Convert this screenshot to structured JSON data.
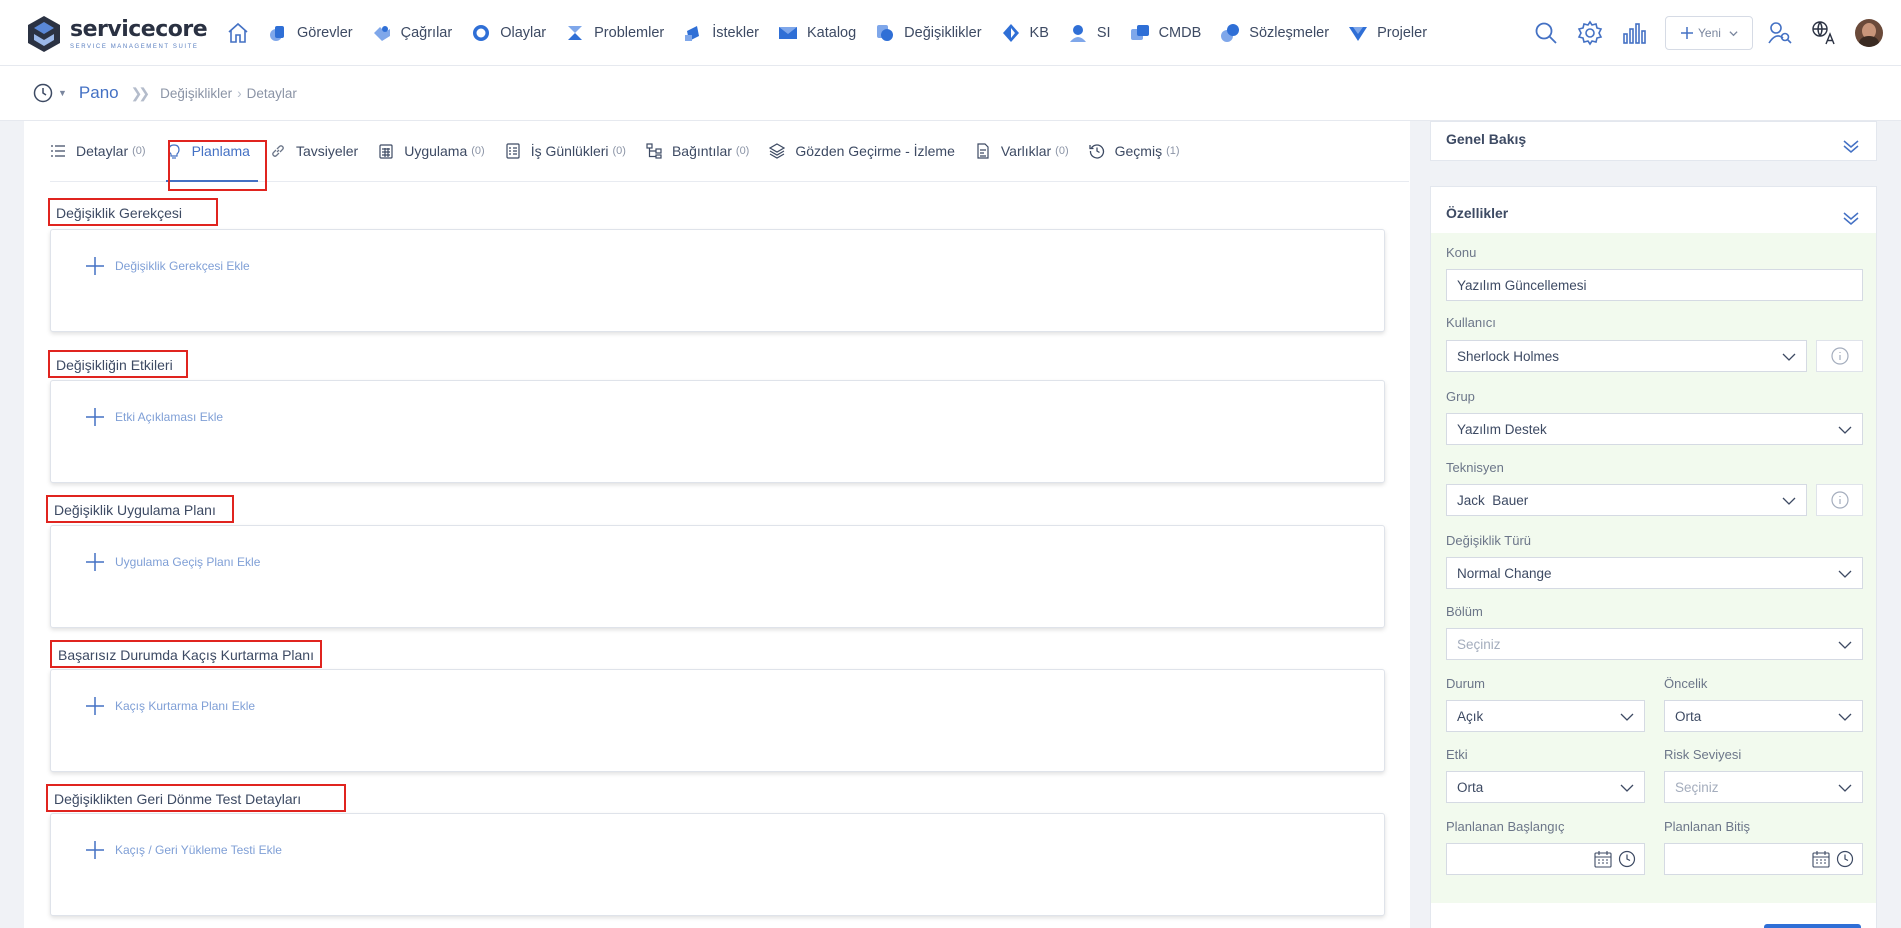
{
  "app": {
    "logo_title": "servicecore",
    "logo_subtitle": "SERVICE MANAGEMENT SUITE"
  },
  "colors": {
    "accent": "#4471c4",
    "highlight": "#e0241f",
    "panel_bg": "#f2faee"
  },
  "nav": {
    "items": [
      {
        "label": "Görevler",
        "icon": "tasks-icon"
      },
      {
        "label": "Çağrılar",
        "icon": "calls-icon"
      },
      {
        "label": "Olaylar",
        "icon": "incidents-icon"
      },
      {
        "label": "Problemler",
        "icon": "problems-icon"
      },
      {
        "label": "İstekler",
        "icon": "requests-icon"
      },
      {
        "label": "Katalog",
        "icon": "catalog-icon"
      },
      {
        "label": "Değişiklikler",
        "icon": "changes-icon"
      },
      {
        "label": "KB",
        "icon": "kb-icon"
      },
      {
        "label": "SI",
        "icon": "si-icon"
      },
      {
        "label": "CMDB",
        "icon": "cmdb-icon"
      },
      {
        "label": "Sözleşmeler",
        "icon": "contracts-icon"
      },
      {
        "label": "Projeler",
        "icon": "projects-icon"
      }
    ],
    "new_label": "Yeni"
  },
  "breadcrumb": {
    "home": "Pano",
    "section": "Değişiklikler",
    "page": "Detaylar"
  },
  "tabs": [
    {
      "label": "Detaylar",
      "count": "(0)"
    },
    {
      "label": "Planlama",
      "count": ""
    },
    {
      "label": "Tavsiyeler",
      "count": ""
    },
    {
      "label": "Uygulama",
      "count": "(0)"
    },
    {
      "label": "İş Günlükleri",
      "count": "(0)"
    },
    {
      "label": "Bağıntılar",
      "count": "(0)"
    },
    {
      "label": "Gözden Geçirme - İzleme",
      "count": ""
    },
    {
      "label": "Varlıklar",
      "count": "(0)"
    },
    {
      "label": "Geçmiş",
      "count": "(1)"
    }
  ],
  "sections": [
    {
      "title": "Değişiklik Gerekçesi",
      "add_label": "Değişiklik Gerekçesi Ekle"
    },
    {
      "title": "Değişikliğin Etkileri",
      "add_label": "Etki Açıklaması Ekle"
    },
    {
      "title": "Değişiklik Uygulama Planı",
      "add_label": "Uygulama Geçiş Planı Ekle"
    },
    {
      "title": "Başarısız Durumda Kaçış Kurtarma Planı",
      "add_label": "Kaçış Kurtarma Planı Ekle"
    },
    {
      "title": "Değişiklikten Geri Dönme Test Detayları",
      "add_label": "Kaçış / Geri Yükleme Testi Ekle"
    }
  ],
  "overview": {
    "title": "Genel Bakış"
  },
  "properties": {
    "title": "Özellikler",
    "konu": {
      "label": "Konu",
      "value": "Yazılım Güncellemesi"
    },
    "kullanici": {
      "label": "Kullanıcı",
      "value": "Sherlock Holmes"
    },
    "grup": {
      "label": "Grup",
      "value": "Yazılım Destek"
    },
    "teknisyen": {
      "label": "Teknisyen",
      "value": "Jack  Bauer"
    },
    "degisiklik_turu": {
      "label": "Değişiklik Türü",
      "value": "Normal Change"
    },
    "bolum": {
      "label": "Bölüm",
      "placeholder": "Seçiniz"
    },
    "durum": {
      "label": "Durum",
      "value": "Açık"
    },
    "oncelik": {
      "label": "Öncelik",
      "value": "Orta"
    },
    "etki": {
      "label": "Etki",
      "value": "Orta"
    },
    "risk": {
      "label": "Risk Seviyesi",
      "placeholder": "Seçiniz"
    },
    "baslangic": {
      "label": "Planlanan Başlangıç",
      "value": ""
    },
    "bitis": {
      "label": "Planlanan Bitiş",
      "value": ""
    }
  }
}
